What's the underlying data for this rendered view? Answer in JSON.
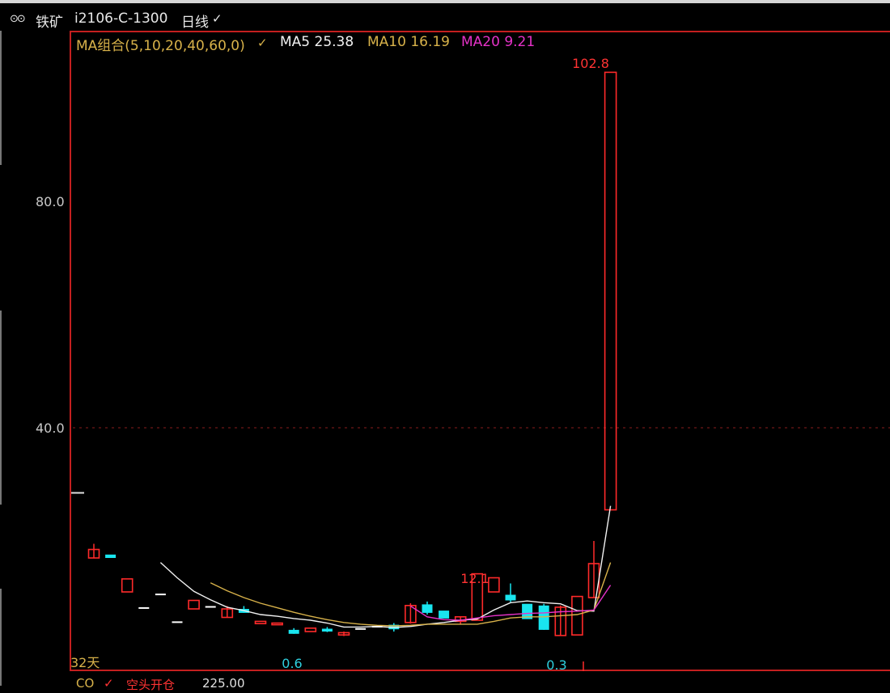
{
  "header": {
    "link_icon_glyph": "⊙⊙",
    "instrument_name": "铁矿",
    "contract_code": "i2106-C-1300",
    "period": "日线",
    "dropdown_glyph": "✓"
  },
  "legend": {
    "combo_label": "MA组合(5,10,20,40,60,0)",
    "dropdown_glyph": "✓",
    "ma5": "MA5 25.38",
    "ma10": "MA10 16.19",
    "ma20": "MA20 9.21"
  },
  "colors": {
    "frame": "#c41f1f",
    "up": "#ff2a2a",
    "down": "#19e5ef",
    "flat": "#ffffff",
    "ma5": "#f2f2f2",
    "ma10": "#d8b24a",
    "ma20": "#e632c8",
    "gridline": "#8a1d1d",
    "high_label": "#ff3333",
    "low_label": "#2fd0df"
  },
  "bottom": {
    "indicator": "CO",
    "dropdown_glyph": "✓",
    "label": "空头开仓",
    "value": "225.00"
  },
  "chart_data": {
    "type": "candlestick",
    "ylim": [
      0,
      112
    ],
    "yticks": [
      {
        "value": 80,
        "label": "80.0"
      },
      {
        "value": 40,
        "label": "40.0"
      }
    ],
    "annotations": {
      "high": {
        "text": "102.8",
        "value": 102.8
      },
      "local_high": {
        "text": "12.1",
        "value": 12.1
      },
      "low_left": {
        "text": "0.6",
        "value": 0.6
      },
      "low_right": {
        "text": "0.3",
        "value": 0.3
      },
      "days": "32天",
      "prev_close_marker": 28.5
    },
    "candles": [
      {
        "o": 18.5,
        "c": 17.0,
        "h": 19.5,
        "l": 17.0,
        "dir": "up"
      },
      {
        "o": 17.6,
        "c": 17.0,
        "h": 17.6,
        "l": 17.0,
        "dir": "down"
      },
      {
        "o": 13.3,
        "c": 11.0,
        "h": 13.3,
        "l": 11.0,
        "dir": "up"
      },
      {
        "o": 8.3,
        "c": 8.3,
        "h": 8.3,
        "l": 8.3,
        "dir": "flat"
      },
      {
        "o": 10.7,
        "c": 10.7,
        "h": 10.7,
        "l": 10.7,
        "dir": "flat"
      },
      {
        "o": 5.8,
        "c": 5.8,
        "h": 5.8,
        "l": 5.8,
        "dir": "flat"
      },
      {
        "o": 9.5,
        "c": 8.0,
        "h": 9.5,
        "l": 8.0,
        "dir": "up"
      },
      {
        "o": 8.5,
        "c": 8.5,
        "h": 8.5,
        "l": 8.5,
        "dir": "flat"
      },
      {
        "o": 8.0,
        "c": 6.5,
        "h": 8.5,
        "l": 6.5,
        "dir": "up"
      },
      {
        "o": 8.0,
        "c": 7.3,
        "h": 8.5,
        "l": 7.3,
        "dir": "down"
      },
      {
        "o": 5.8,
        "c": 5.4,
        "h": 5.8,
        "l": 5.4,
        "dir": "up"
      },
      {
        "o": 5.5,
        "c": 5.2,
        "h": 5.5,
        "l": 5.2,
        "dir": "up"
      },
      {
        "o": 4.3,
        "c": 3.6,
        "h": 4.6,
        "l": 3.6,
        "dir": "down"
      },
      {
        "o": 4.6,
        "c": 4.0,
        "h": 4.6,
        "l": 4.0,
        "dir": "up"
      },
      {
        "o": 4.5,
        "c": 4.0,
        "h": 4.8,
        "l": 3.9,
        "dir": "down"
      },
      {
        "o": 3.8,
        "c": 3.4,
        "h": 4.0,
        "l": 3.2,
        "dir": "up"
      },
      {
        "o": 4.6,
        "c": 4.6,
        "h": 4.6,
        "l": 4.6,
        "dir": "flat"
      },
      {
        "o": 5.0,
        "c": 5.0,
        "h": 5.0,
        "l": 5.0,
        "dir": "flat"
      },
      {
        "o": 5.2,
        "c": 4.4,
        "h": 5.5,
        "l": 4.0,
        "dir": "down"
      },
      {
        "o": 8.6,
        "c": 5.6,
        "h": 9.0,
        "l": 5.4,
        "dir": "up"
      },
      {
        "o": 8.8,
        "c": 7.3,
        "h": 9.3,
        "l": 7.0,
        "dir": "down"
      },
      {
        "o": 7.7,
        "c": 6.3,
        "h": 7.7,
        "l": 6.3,
        "dir": "down"
      },
      {
        "o": 6.6,
        "c": 5.8,
        "h": 6.6,
        "l": 5.2,
        "dir": "up"
      },
      {
        "o": 14.2,
        "c": 6.0,
        "h": 14.2,
        "l": 6.0,
        "dir": "up"
      },
      {
        "o": 13.5,
        "c": 11.0,
        "h": 13.5,
        "l": 11.0,
        "dir": "up"
      },
      {
        "o": 10.5,
        "c": 9.5,
        "h": 12.5,
        "l": 9.2,
        "dir": "down"
      },
      {
        "o": 8.9,
        "c": 6.2,
        "h": 8.9,
        "l": 6.2,
        "dir": "down"
      },
      {
        "o": 8.6,
        "c": 4.3,
        "h": 8.9,
        "l": 4.3,
        "dir": "down"
      },
      {
        "o": 8.3,
        "c": 3.3,
        "h": 8.6,
        "l": 3.3,
        "dir": "up"
      },
      {
        "o": 10.2,
        "c": 3.4,
        "h": 10.2,
        "l": 3.4,
        "dir": "up"
      },
      {
        "o": 16.0,
        "c": 10.0,
        "h": 20.0,
        "l": 10.0,
        "dir": "up"
      },
      {
        "o": 102.8,
        "c": 25.5,
        "h": 102.8,
        "l": 0.3,
        "dir": "up"
      }
    ],
    "series": [
      {
        "name": "MA5",
        "values": [
          null,
          null,
          null,
          null,
          16.2,
          13.5,
          11.1,
          9.6,
          8.3,
          7.7,
          7.0,
          6.7,
          6.3,
          6.0,
          5.5,
          4.8,
          4.8,
          4.9,
          4.7,
          4.9,
          5.3,
          5.6,
          6.0,
          6.2,
          7.8,
          9.1,
          9.4,
          9.1,
          8.9,
          7.7,
          7.6,
          26.2
        ]
      },
      {
        "name": "MA10",
        "values": [
          null,
          null,
          null,
          null,
          null,
          null,
          null,
          12.6,
          11.2,
          10.0,
          9.0,
          8.2,
          7.4,
          6.7,
          6.1,
          5.6,
          5.3,
          5.1,
          5.0,
          5.1,
          5.3,
          5.3,
          5.3,
          5.3,
          5.8,
          6.4,
          6.6,
          6.6,
          6.8,
          7.0,
          7.8,
          16.2
        ]
      },
      {
        "name": "MA20",
        "values": [
          null,
          null,
          null,
          null,
          null,
          null,
          null,
          null,
          null,
          null,
          null,
          null,
          null,
          null,
          null,
          null,
          null,
          null,
          null,
          8.5,
          6.6,
          6.1,
          6.0,
          6.4,
          6.8,
          7.0,
          7.2,
          7.3,
          7.5,
          7.6,
          7.8,
          12.2
        ]
      }
    ]
  }
}
